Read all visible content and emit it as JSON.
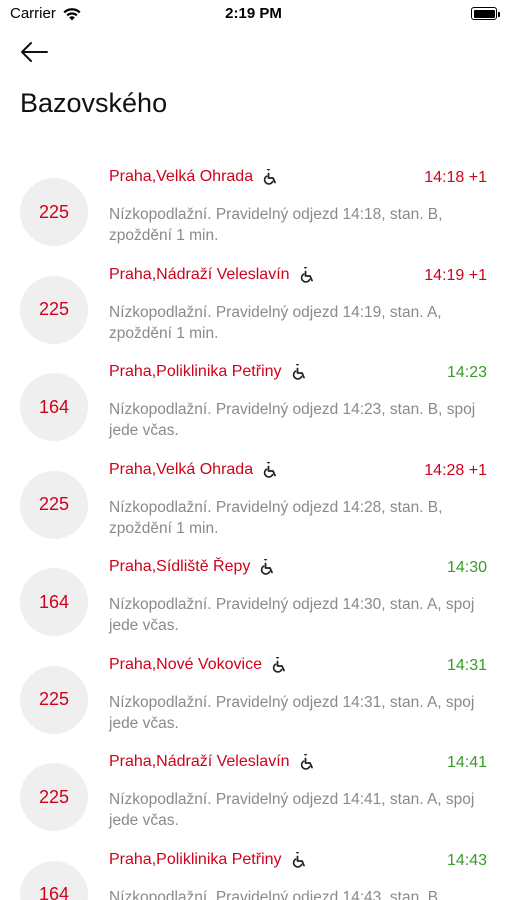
{
  "status_bar": {
    "carrier": "Carrier",
    "time": "2:19 PM"
  },
  "header": {
    "title": "Bazovského"
  },
  "colors": {
    "accent_red": "#d0021b",
    "ontime_green": "#3a9a2a",
    "badge_bg": "#efefef",
    "desc_gray": "#8a8a8a"
  },
  "icons": {
    "back": "back-arrow-icon",
    "accessibility": "wheelchair-icon",
    "wifi": "wifi-icon",
    "battery": "battery-icon"
  },
  "departures": [
    {
      "line": "225",
      "destination": "Praha,Velká Ohrada",
      "time": "14:18 +1",
      "status": "late",
      "description": "Nízkopodlažní. Pravidelný odjezd 14:18, stan. B, zpoždění 1 min."
    },
    {
      "line": "225",
      "destination": "Praha,Nádraží Veleslavín",
      "time": "14:19 +1",
      "status": "late",
      "description": "Nízkopodlažní. Pravidelný odjezd 14:19, stan. A, zpoždění 1 min."
    },
    {
      "line": "164",
      "destination": "Praha,Poliklinika Petřiny",
      "time": "14:23",
      "status": "ontime",
      "description": "Nízkopodlažní. Pravidelný odjezd 14:23, stan. B, spoj jede včas."
    },
    {
      "line": "225",
      "destination": "Praha,Velká Ohrada",
      "time": "14:28 +1",
      "status": "late",
      "description": "Nízkopodlažní. Pravidelný odjezd 14:28, stan. B, zpoždění 1 min."
    },
    {
      "line": "164",
      "destination": "Praha,Sídliště Řepy",
      "time": "14:30",
      "status": "ontime",
      "description": "Nízkopodlažní. Pravidelný odjezd 14:30, stan. A, spoj jede včas."
    },
    {
      "line": "225",
      "destination": "Praha,Nové Vokovice",
      "time": "14:31",
      "status": "ontime",
      "description": "Nízkopodlažní. Pravidelný odjezd 14:31, stan. A, spoj jede včas."
    },
    {
      "line": "225",
      "destination": "Praha,Nádraží Veleslavín",
      "time": "14:41",
      "status": "ontime",
      "description": "Nízkopodlažní. Pravidelný odjezd 14:41, stan. A, spoj jede včas."
    },
    {
      "line": "164",
      "destination": "Praha,Poliklinika Petřiny",
      "time": "14:43",
      "status": "ontime",
      "description": "Nízkopodlažní. Pravidelný odjezd 14:43, stan. B"
    }
  ]
}
